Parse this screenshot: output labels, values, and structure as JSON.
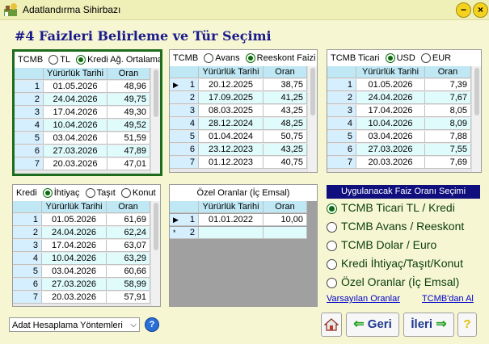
{
  "window": {
    "title": "Adatlandırma Sihirbazı"
  },
  "heading": "#4 Faizleri Belirleme ve Tür Seçimi",
  "panel1": {
    "label": "TCMB",
    "options": [
      "TL",
      "Kredi Ağ. Ortalama"
    ],
    "columns": [
      "Yürürlük Tarihi",
      "Oran"
    ],
    "rows": [
      {
        "n": "1",
        "date": "01.05.2026",
        "rate": "48,96"
      },
      {
        "n": "2",
        "date": "24.04.2026",
        "rate": "49,75"
      },
      {
        "n": "3",
        "date": "17.04.2026",
        "rate": "49,30"
      },
      {
        "n": "4",
        "date": "10.04.2026",
        "rate": "49,52"
      },
      {
        "n": "5",
        "date": "03.04.2026",
        "rate": "51,59"
      },
      {
        "n": "6",
        "date": "27.03.2026",
        "rate": "47,89"
      },
      {
        "n": "7",
        "date": "20.03.2026",
        "rate": "47,01"
      }
    ]
  },
  "panel2": {
    "label": "TCMB",
    "options": [
      "Avans",
      "Reeskont Faizi"
    ],
    "columns": [
      "Yürürlük Tarihi",
      "Oran"
    ],
    "rows": [
      {
        "n": "1",
        "date": "20.12.2025",
        "rate": "38,75"
      },
      {
        "n": "2",
        "date": "17.09.2025",
        "rate": "41,25"
      },
      {
        "n": "3",
        "date": "08.03.2025",
        "rate": "43,25"
      },
      {
        "n": "4",
        "date": "28.12.2024",
        "rate": "48,25"
      },
      {
        "n": "5",
        "date": "01.04.2024",
        "rate": "50,75"
      },
      {
        "n": "6",
        "date": "23.12.2023",
        "rate": "43,25"
      },
      {
        "n": "7",
        "date": "01.12.2023",
        "rate": "40,75"
      }
    ]
  },
  "panel3": {
    "label": "TCMB Ticari",
    "options": [
      "USD",
      "EUR"
    ],
    "columns": [
      "Yürürlük Tarihi",
      "Oran"
    ],
    "rows": [
      {
        "n": "1",
        "date": "01.05.2026",
        "rate": "7,39"
      },
      {
        "n": "2",
        "date": "24.04.2026",
        "rate": "7,67"
      },
      {
        "n": "3",
        "date": "17.04.2026",
        "rate": "8,05"
      },
      {
        "n": "4",
        "date": "10.04.2026",
        "rate": "8,09"
      },
      {
        "n": "5",
        "date": "03.04.2026",
        "rate": "7,88"
      },
      {
        "n": "6",
        "date": "27.03.2026",
        "rate": "7,55"
      },
      {
        "n": "7",
        "date": "20.03.2026",
        "rate": "7,69"
      }
    ]
  },
  "panel4": {
    "label": "Kredi",
    "options": [
      "İhtiyaç",
      "Taşıt",
      "Konut"
    ],
    "columns": [
      "Yürürlük Tarihi",
      "Oran"
    ],
    "rows": [
      {
        "n": "1",
        "date": "01.05.2026",
        "rate": "61,69"
      },
      {
        "n": "2",
        "date": "24.04.2026",
        "rate": "62,24"
      },
      {
        "n": "3",
        "date": "17.04.2026",
        "rate": "63,07"
      },
      {
        "n": "4",
        "date": "10.04.2026",
        "rate": "63,29"
      },
      {
        "n": "5",
        "date": "03.04.2026",
        "rate": "60,66"
      },
      {
        "n": "6",
        "date": "27.03.2026",
        "rate": "58,99"
      },
      {
        "n": "7",
        "date": "20.03.2026",
        "rate": "57,91"
      }
    ]
  },
  "panel5": {
    "title": "Özel Oranlar (İç Emsal)",
    "columns": [
      "Yürürlük Tarihi",
      "Oran"
    ],
    "rows": [
      {
        "n": "1",
        "date": "01.01.2022",
        "rate": "10,00"
      },
      {
        "n": "2",
        "date": "",
        "rate": ""
      }
    ],
    "new_row_marker": "*"
  },
  "rate_selection": {
    "header": "Uygulanacak Faiz Oranı Seçimi",
    "options": [
      "TCMB Ticari TL / Kredi",
      "TCMB Avans / Reeskont",
      "TCMB Dolar / Euro",
      "Kredi İhtiyaç/Taşıt/Konut",
      "Özel Oranlar (İç Emsal)"
    ],
    "default_link": "Varsayılan Oranlar",
    "tcmb_link": "TCMB'dan Al"
  },
  "footer": {
    "method_select": "Adat Hesaplama Yöntemleri",
    "help": "?",
    "back_label": "Geri",
    "next_label": "İleri"
  },
  "colors": {
    "accent_green": "#1d6b1d",
    "heading_blue": "#1a1a8c",
    "panel_header": "#0f0f7e"
  }
}
